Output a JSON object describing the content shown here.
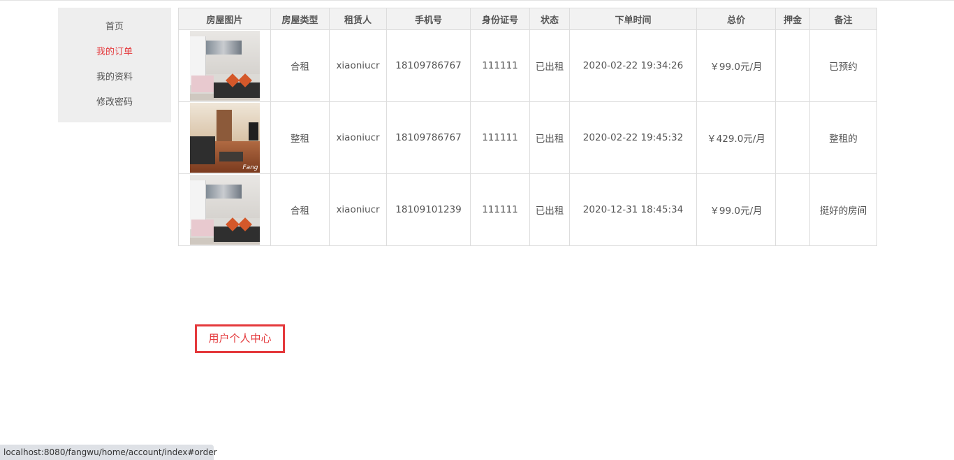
{
  "sidebar": {
    "items": [
      {
        "label": "首页",
        "active": false
      },
      {
        "label": "我的订单",
        "active": true
      },
      {
        "label": "我的资料",
        "active": false
      },
      {
        "label": "修改密码",
        "active": false
      }
    ]
  },
  "table": {
    "headers": [
      "房屋图片",
      "房屋类型",
      "租赁人",
      "手机号",
      "身份证号",
      "状态",
      "下单时间",
      "总价",
      "押金",
      "备注"
    ],
    "rows": [
      {
        "image": "room-photo-shared",
        "type": "合租",
        "tenant": "xiaoniucr",
        "phone": "18109786767",
        "id_number": "111111",
        "status": "已出租",
        "order_time": "2020-02-22 19:34:26",
        "total": "￥99.0元/月",
        "deposit": "",
        "note": "已预约"
      },
      {
        "image": "room-photo-whole",
        "type": "整租",
        "tenant": "xiaoniucr",
        "phone": "18109786767",
        "id_number": "111111",
        "status": "已出租",
        "order_time": "2020-02-22 19:45:32",
        "total": "￥429.0元/月",
        "deposit": "",
        "note": "整租的"
      },
      {
        "image": "room-photo-shared",
        "type": "合租",
        "tenant": "xiaoniucr",
        "phone": "18109101239",
        "id_number": "111111",
        "status": "已出租",
        "order_time": "2020-12-31 18:45:34",
        "total": "￥99.0元/月",
        "deposit": "",
        "note": "挺好的房间"
      }
    ]
  },
  "badge": {
    "label": "用户个人中心"
  },
  "status_bar": {
    "url": "localhost:8080/fangwu/home/account/index#order"
  },
  "colors": {
    "accent": "#e4393c",
    "sidebar_bg": "#eeeeee",
    "header_bg": "#f2f2f2",
    "border": "#dddddd",
    "text": "#555555"
  }
}
